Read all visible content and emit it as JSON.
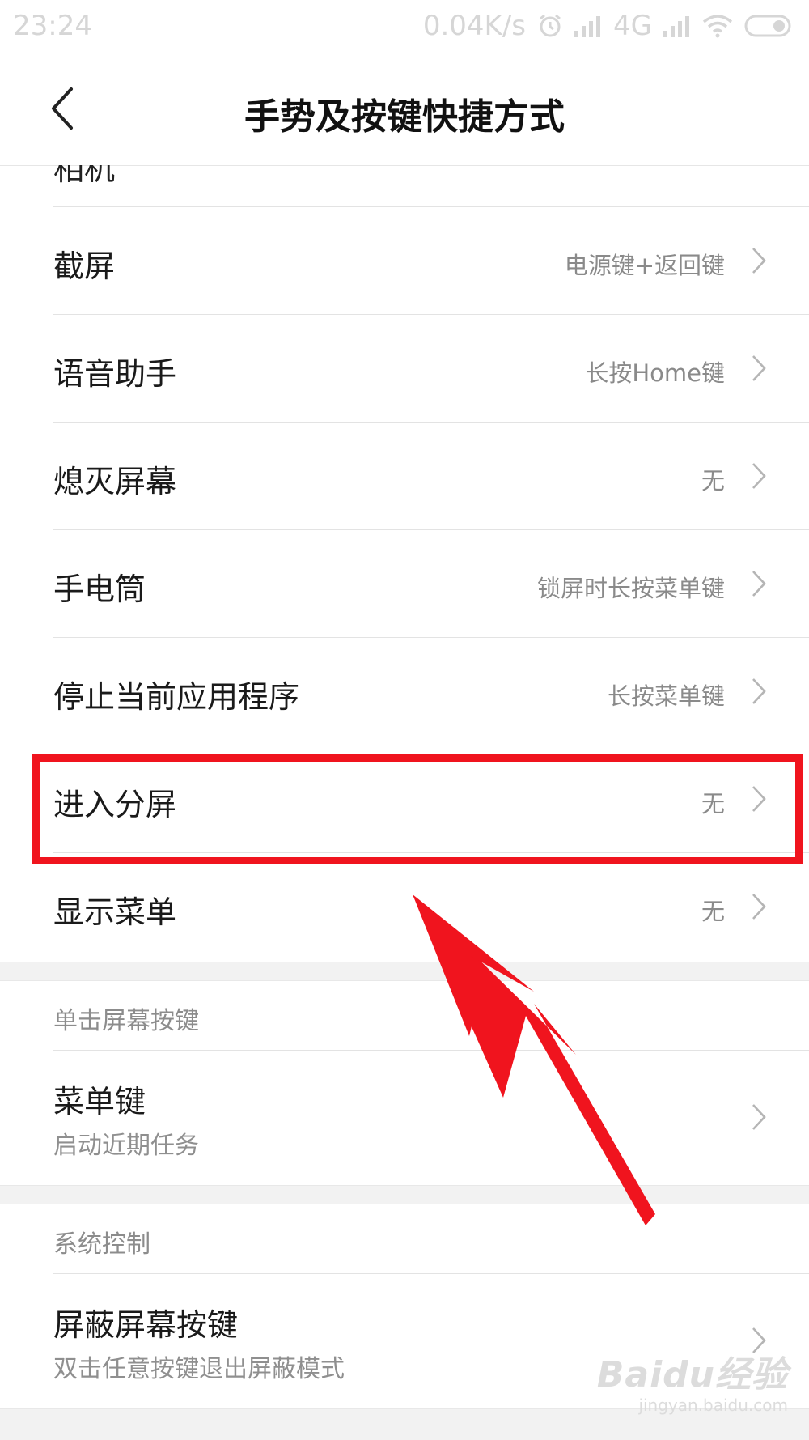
{
  "status_bar": {
    "time": "23:24",
    "net_speed": "0.04K/s",
    "network": "4G",
    "icons": [
      "alarm-icon",
      "signal-icon",
      "signal-icon",
      "wifi-icon",
      "battery-icon"
    ]
  },
  "header": {
    "back_icon": "chevron-left-icon",
    "title": "手势及按键快捷方式"
  },
  "partial_row": {
    "label": "相机"
  },
  "rows": [
    {
      "label": "截屏",
      "value": "电源键+返回键"
    },
    {
      "label": "语音助手",
      "value": "长按Home键"
    },
    {
      "label": "熄灭屏幕",
      "value": "无"
    },
    {
      "label": "手电筒",
      "value": "锁屏时长按菜单键"
    },
    {
      "label": "停止当前应用程序",
      "value": "长按菜单键"
    },
    {
      "label": "进入分屏",
      "value": "无"
    },
    {
      "label": "显示菜单",
      "value": "无"
    }
  ],
  "sections": [
    {
      "header": "单击屏幕按键",
      "items": [
        {
          "label": "菜单键",
          "sub": "启动近期任务"
        }
      ]
    },
    {
      "header": "系统控制",
      "items": [
        {
          "label": "屏蔽屏幕按键",
          "sub": "双击任意按键退出屏蔽模式"
        }
      ]
    }
  ],
  "annotation": {
    "highlight_color": "#f0141e",
    "arrow_color": "#f0141e"
  },
  "watermark": {
    "main": "Baidu经验",
    "sub": "jingyan.baidu.com"
  }
}
